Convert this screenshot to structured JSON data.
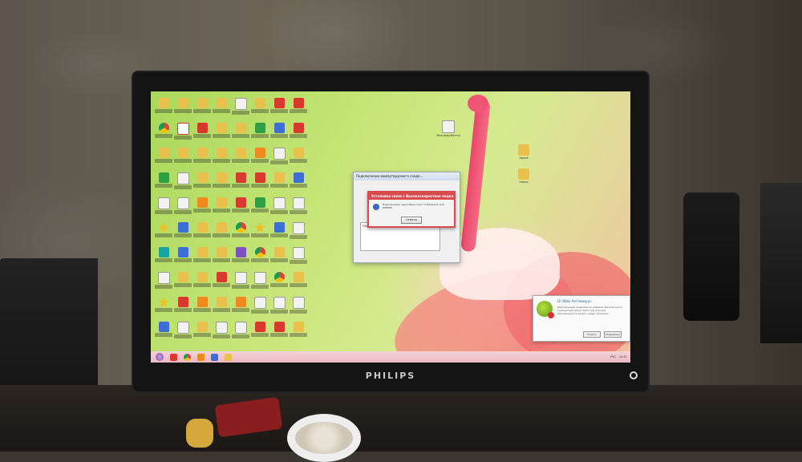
{
  "monitor": {
    "brand": "PHILIPS"
  },
  "desktop": {
    "icon_rows": [
      [
        "folder",
        "folder",
        "folder",
        "folder",
        "white",
        "folder",
        "red",
        "red"
      ],
      [
        "chrome",
        "yandex",
        "red",
        "folder",
        "folder",
        "green",
        "blue",
        "red"
      ],
      [
        "folder",
        "folder",
        "folder",
        "folder",
        "folder",
        "orange",
        "white",
        "folder"
      ],
      [
        "green",
        "white",
        "folder",
        "folder",
        "red",
        "red",
        "folder",
        "blue"
      ],
      [
        "white",
        "white",
        "orange",
        "folder",
        "red",
        "green",
        "white",
        "white"
      ],
      [
        "star",
        "blue",
        "folder",
        "folder",
        "chrome",
        "star",
        "blue",
        "white"
      ],
      [
        "teal",
        "blue",
        "folder",
        "folder",
        "purple",
        "chrome",
        "folder",
        "white"
      ],
      [
        "white",
        "folder",
        "folder",
        "red",
        "white",
        "white",
        "chrome",
        "folder"
      ],
      [
        "star",
        "red",
        "orange",
        "folder",
        "orange",
        "white",
        "white",
        "white"
      ],
      [
        "blue",
        "white",
        "folder",
        "white",
        "white",
        "red",
        "red",
        "folder"
      ]
    ],
    "free_icons": [
      {
        "icon": "document-icon",
        "label": "Мои документы"
      },
      {
        "icon": "folder-icon",
        "label": "Архив"
      },
      {
        "icon": "folder-icon",
        "label": "папка"
      }
    ]
  },
  "dialogs": {
    "connect": {
      "title": "Подключение коммутируемого соеди...",
      "status_text": "Попытка соединения 1..."
    },
    "error": {
      "title": "Установка связи с Высокоскоростное подкл...",
      "message": "Подключение через Мини-порт глобальной сети (PPPOE)",
      "button_label": "Отмена"
    }
  },
  "antivirus": {
    "title": "Dr.Web Антивирус",
    "message": "Действующая лицензия не найдена. Безопасность компьютера может быть под угрозой. Рекомендуется купить новую лицензию.",
    "buy_label": "Купить",
    "details_label": "Подробнее"
  },
  "taskbar": {
    "language": "РУС",
    "time": "10:41"
  }
}
